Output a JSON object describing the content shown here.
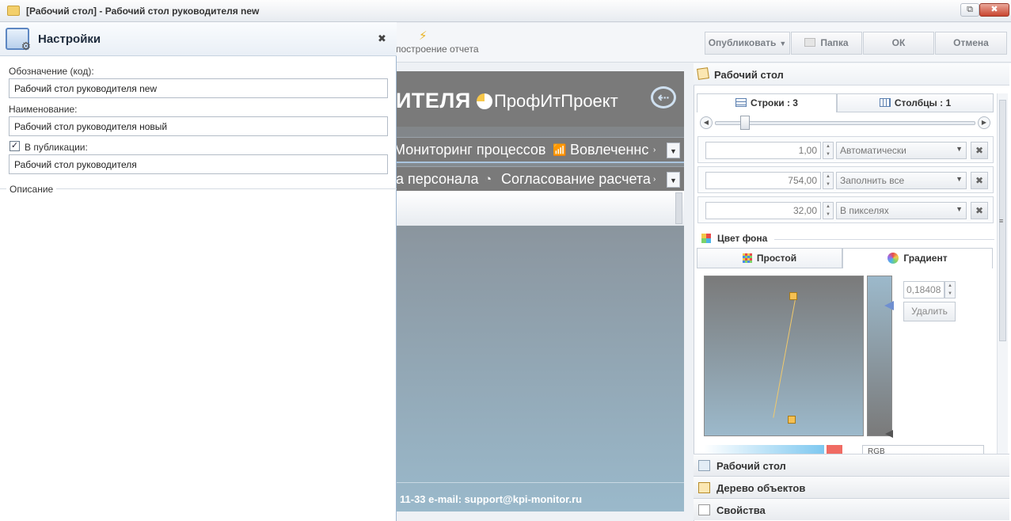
{
  "window": {
    "title": "[Рабочий стол] - Рабочий стол руководителя new",
    "restore_label": "⧉",
    "close_label": "✖"
  },
  "toolbar": {
    "build_report_label": "построение отчета",
    "publish_label": "Опубликовать",
    "folder_label": "Папка",
    "ok_label": "ОК",
    "cancel_label": "Отмена"
  },
  "settings": {
    "title": "Настройки",
    "close_label": "✖",
    "code_label": "Обозначение (код):",
    "code_value": "Рабочий стол руководителя new",
    "name_label": "Наименование:",
    "name_value": "Рабочий стол руководителя новый",
    "publish_checkbox_label": "В публикации:",
    "publish_checked": true,
    "publish_value": "Рабочий стол руководителя",
    "description_label": "Описание"
  },
  "preview": {
    "banner_text": "ИТЕЛЯ",
    "logo_text": "ПрофИтПроект",
    "nav_row1": [
      "Мониторинг процессов",
      "Вовлеченнс"
    ],
    "nav_row2": [
      "а персонала",
      "Согласование расчета"
    ],
    "footer_text": "11-33 e-mail: support@kpi-monitor.ru"
  },
  "right_panel": {
    "header_title": "Рабочий стол",
    "tab_rows": "Строки : 3",
    "tab_cols": "Столбцы : 1",
    "rows": [
      {
        "value": "1,00",
        "mode": "Автоматически"
      },
      {
        "value": "754,00",
        "mode": "Заполнить все"
      },
      {
        "value": "32,00",
        "mode": "В пикселях"
      }
    ],
    "bg_color_title": "Цвет фона",
    "color_tab_simple": "Простой",
    "color_tab_gradient": "Градиент",
    "gradient_value": "0,18408",
    "delete_label": "Удалить",
    "color_mode": "RGB"
  },
  "accordion": {
    "desktop": "Рабочий стол",
    "object_tree": "Дерево объектов",
    "properties": "Свойства"
  },
  "colors": {
    "accent": "#6f8fd0",
    "gradient_top": "#7a7a7a",
    "gradient_bottom": "#9cb9cb",
    "marker": "#f5c052"
  }
}
